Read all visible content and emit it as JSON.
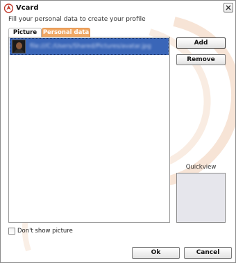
{
  "window": {
    "title": "Vcard",
    "close_icon": "close-icon",
    "app_icon": "vcard-app-icon"
  },
  "subtitle": "Fill your personal data to create your profile",
  "tabs": [
    {
      "label": "Picture",
      "active": true
    },
    {
      "label": "Personal data",
      "active": false,
      "color": "#f0a865"
    }
  ],
  "pictures_list": {
    "items": [
      {
        "name": "file:///C:/Users/Shared/Pictures/avatar.jpg",
        "selected": true,
        "selection_color": "#3a66b8"
      }
    ]
  },
  "buttons": {
    "add": "Add",
    "remove": "Remove",
    "ok": "Ok",
    "cancel": "Cancel"
  },
  "quickview": {
    "label": "Quickview"
  },
  "options": {
    "dont_show_picture_label": "Don't show picture",
    "dont_show_picture_checked": false
  }
}
